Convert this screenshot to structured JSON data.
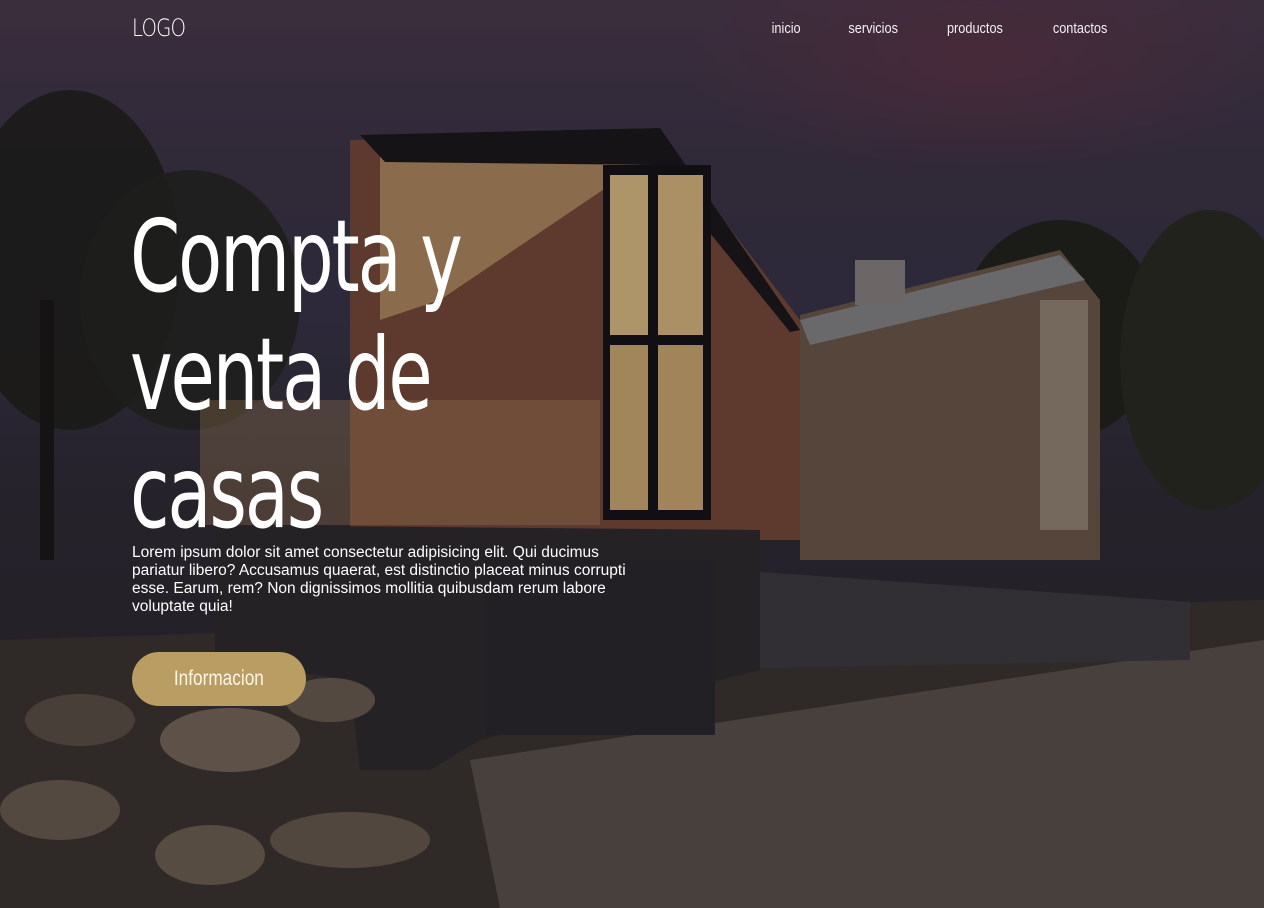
{
  "nav": {
    "logo": "LOGO",
    "items": [
      {
        "label": "inicio"
      },
      {
        "label": "servicios"
      },
      {
        "label": "productos"
      },
      {
        "label": "contactos"
      }
    ]
  },
  "hero": {
    "title": "Compta y venta de casas",
    "description": "Lorem ipsum dolor sit amet consectetur adipisicing elit. Qui ducimus pariatur libero? Accusamus quaerat, est distinctio placeat minus corrupti esse. Earum, rem? Non dignissimos mollitia quibusdam rerum labore voluptate quia!",
    "button_label": "Informacion"
  },
  "colors": {
    "accent": "#b99d62",
    "text": "#ffffff"
  }
}
